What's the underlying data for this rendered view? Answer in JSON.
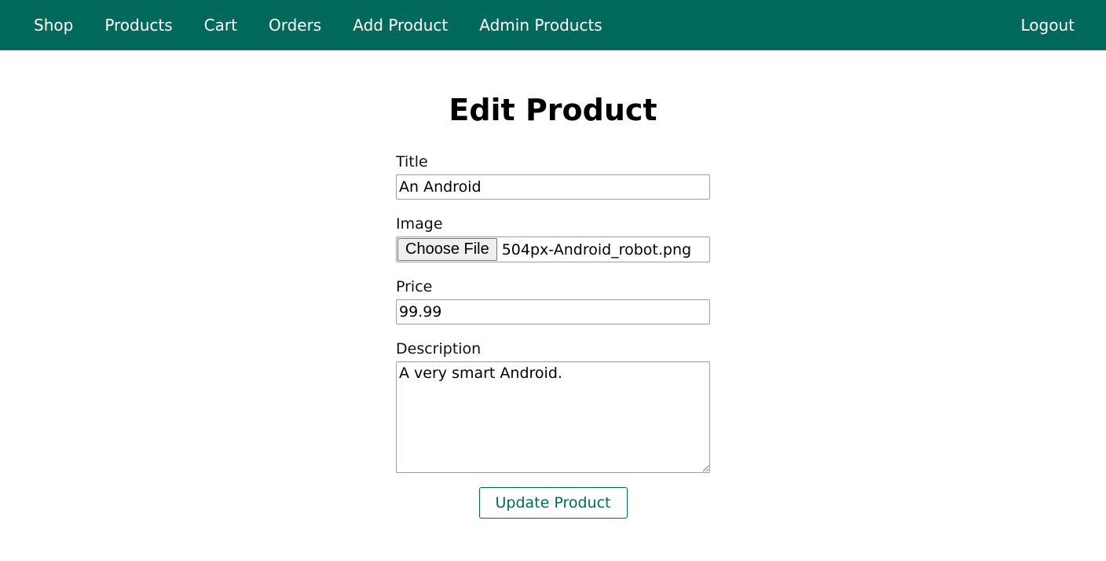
{
  "nav": {
    "items": [
      {
        "label": "Shop"
      },
      {
        "label": "Products"
      },
      {
        "label": "Cart"
      },
      {
        "label": "Orders"
      },
      {
        "label": "Add Product"
      },
      {
        "label": "Admin Products"
      }
    ],
    "logout_label": "Logout"
  },
  "page": {
    "title": "Edit Product"
  },
  "form": {
    "title_label": "Title",
    "title_value": "An Android",
    "image_label": "Image",
    "choose_file_label": "Choose File",
    "image_file_name": "504px-Android_robot.png",
    "price_label": "Price",
    "price_value": "99.99",
    "description_label": "Description",
    "description_value": "A very smart Android.",
    "submit_label": "Update Product"
  },
  "colors": {
    "header_bg": "#00695c",
    "accent": "#00695c"
  }
}
